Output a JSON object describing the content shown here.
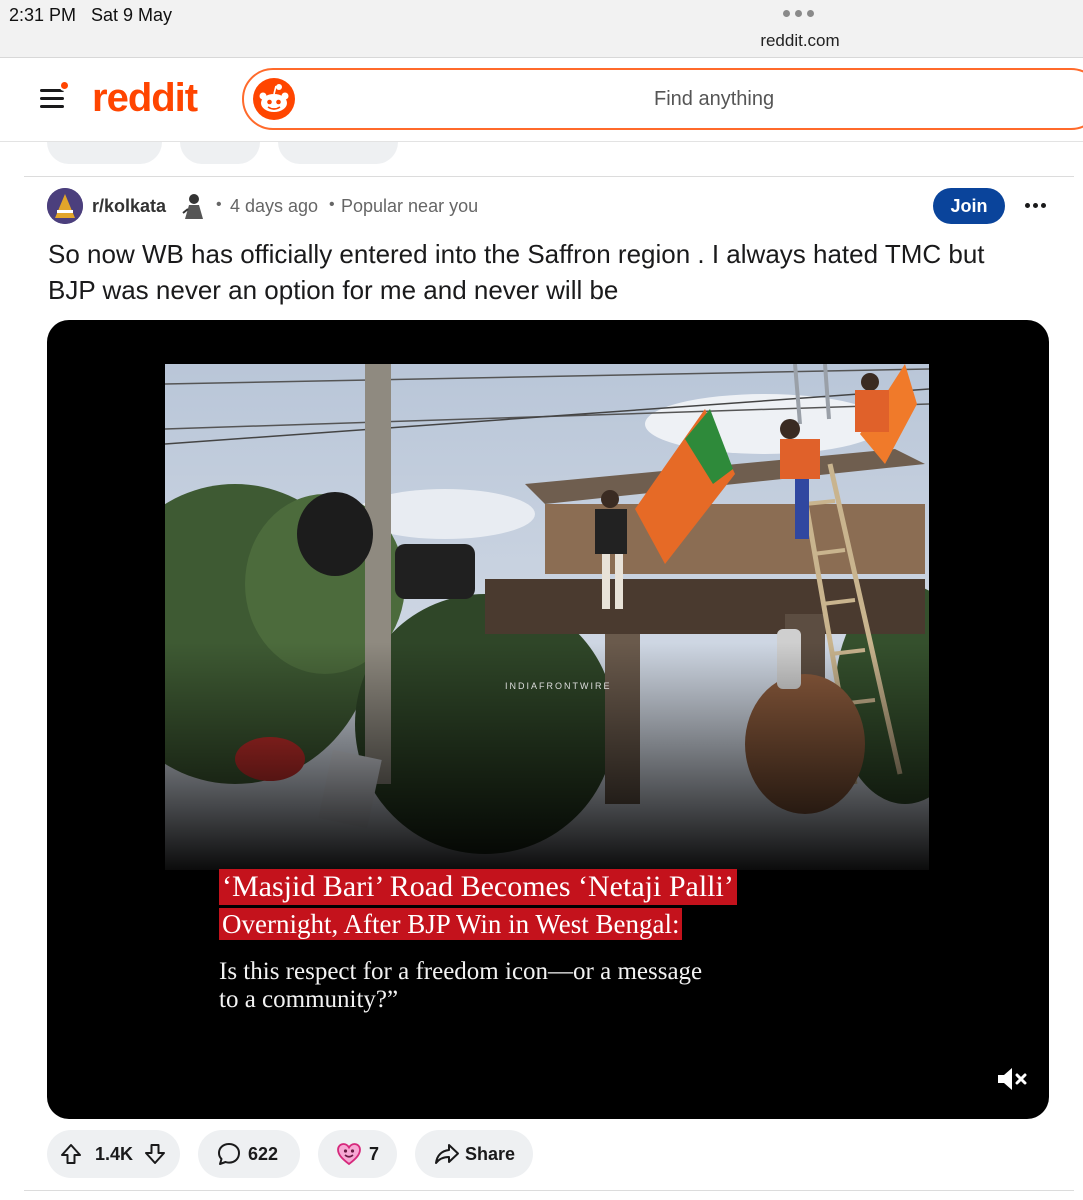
{
  "status_bar": {
    "time": "2:31 PM",
    "date": "Sat 9 May",
    "url": "reddit.com"
  },
  "header": {
    "logo_text": "reddit",
    "search_placeholder": "Find anything",
    "brand_color": "#ff4500"
  },
  "post": {
    "subreddit": "r/kolkata",
    "age": "4 days ago",
    "context": "Popular near you",
    "join_label": "Join",
    "title": "So now WB has officially entered into the Saffron region . I always hated TMC but BJP was never an option for me and never will be",
    "video": {
      "watermark": "INDIAFRONTWIRE",
      "caption_line1": "‘Masjid Bari’ Road Becomes ‘Netaji Palli’",
      "caption_line2": "Overnight, After BJP Win in West Bengal:",
      "caption_line3": "Is this respect for a freedom icon—or a message to a community?”",
      "muted": true
    },
    "actions": {
      "votes": "1.4K",
      "comments": "622",
      "awards": "7",
      "share_label": "Share"
    }
  },
  "icons": [
    "menu-icon",
    "snoo-icon",
    "upvote-icon",
    "downvote-icon",
    "comment-icon",
    "award-icon",
    "share-icon",
    "mute-icon",
    "more-icon"
  ]
}
